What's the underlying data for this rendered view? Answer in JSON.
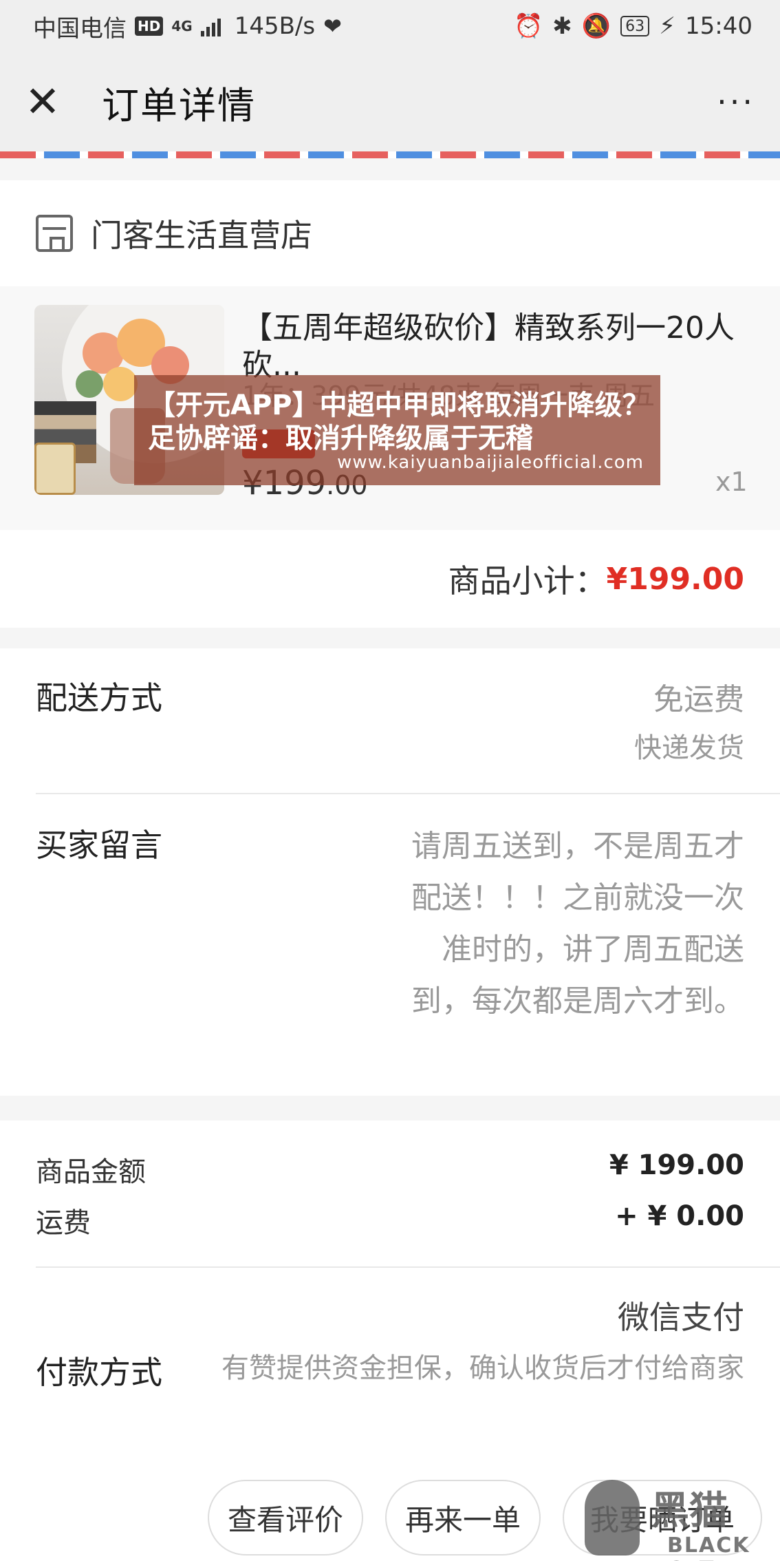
{
  "status_bar": {
    "carrier": "中国电信",
    "hd": "HD",
    "network": "4G",
    "speed": "145B/s",
    "battery": "63",
    "time": "15:40"
  },
  "header": {
    "title": "订单详情",
    "more": "···"
  },
  "shop": {
    "name": "门客生活直营店"
  },
  "product": {
    "title": "【五周年超级砍价】精致系列一20人砍...",
    "spec": "1年：399元/共48束 每周一束 周五",
    "price_main": "¥199",
    "price_cents": ".00",
    "quantity": "x1"
  },
  "watermark": {
    "headline": "【开元APP】中超中甲即将取消升降级？足协辟谣：取消升降级属于无稽",
    "url": "www.kaiyuanbaijialeofficial.com"
  },
  "subtotal": {
    "label": "商品小计：",
    "value": "¥199.00"
  },
  "delivery": {
    "label": "配送方式",
    "fee": "免运费",
    "method": "快递发货"
  },
  "buyer_message": {
    "label": "买家留言",
    "text": "请周五送到，不是周五才配送！！！之前就没一次准时的，讲了周五配送到，每次都是周六才到。"
  },
  "amounts": {
    "goods_label": "商品金额",
    "goods_value": "¥ 199.00",
    "shipping_label": "运费",
    "shipping_value": "+ ¥ 0.00"
  },
  "payment": {
    "label": "付款方式",
    "method": "微信支付",
    "description": "有赞提供资金担保，确认收货后才付给商家"
  },
  "actions": {
    "view_review": "查看评价",
    "reorder": "再来一单",
    "share_order": "我要晒订单"
  },
  "corner_logo": {
    "cn": "黑猫",
    "en": "BLACK CAT"
  }
}
